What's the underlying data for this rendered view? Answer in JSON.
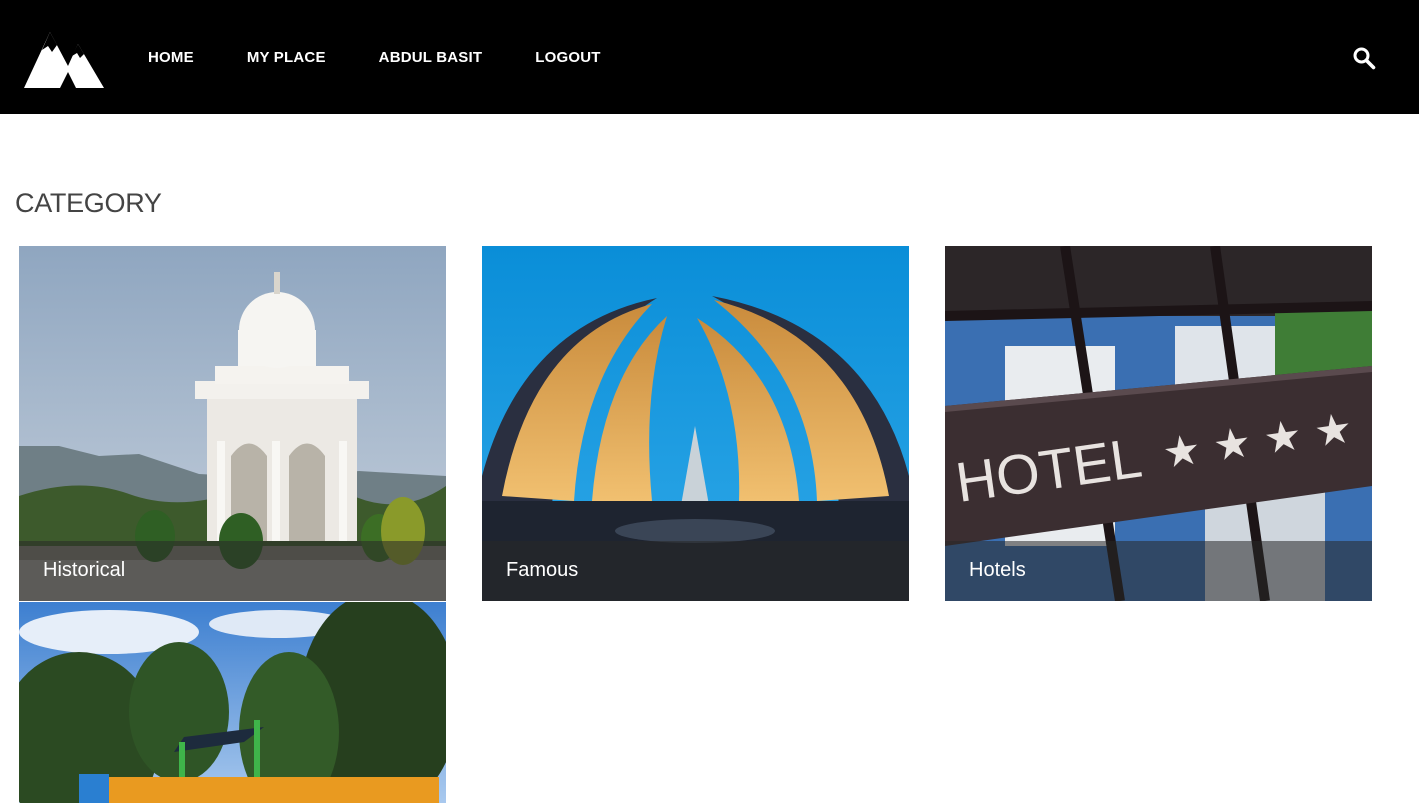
{
  "header": {
    "logo_icon": "mountain-logo-icon",
    "nav": [
      {
        "label": "HOME"
      },
      {
        "label": "MY PLACE"
      },
      {
        "label": "ABDUL BASIT"
      },
      {
        "label": "LOGOUT"
      }
    ],
    "search_icon": "search-icon"
  },
  "main": {
    "heading": "CATEGORY",
    "categories": [
      {
        "label": "Historical"
      },
      {
        "label": "Famous"
      },
      {
        "label": "Hotels"
      },
      {
        "label": ""
      }
    ]
  },
  "colors": {
    "header_bg": "#000000",
    "nav_text": "#ffffff",
    "heading_text": "#444444",
    "page_bg": "#ffffff"
  }
}
